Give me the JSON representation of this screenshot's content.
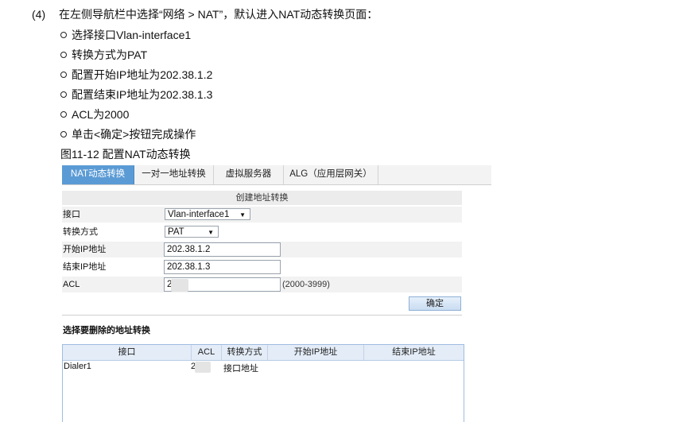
{
  "instructions": {
    "step_number": "(4)",
    "step_text": "在左侧导航栏中选择“网络 > NAT”，默认进入NAT动态转换页面：",
    "bullets": [
      "选择接口Vlan-interface1",
      "转换方式为PAT",
      "配置开始IP地址为202.38.1.2",
      "配置结束IP地址为202.38.1.3",
      "ACL为2000",
      "单击<确定>按钮完成操作"
    ],
    "figure_caption": "图11-12 配置NAT动态转换"
  },
  "tabs": [
    "NAT动态转换",
    "一对一地址转换",
    "虚拟服务器",
    "ALG（应用层网关）"
  ],
  "form": {
    "title": "创建地址转换",
    "interface_label": "接口",
    "interface_value": "Vlan-interface1",
    "mode_label": "转换方式",
    "mode_value": "PAT",
    "start_ip_label": "开始IP地址",
    "start_ip_value": "202.38.1.2",
    "end_ip_label": "结束IP地址",
    "end_ip_value": "202.38.1.3",
    "acl_label": "ACL",
    "acl_value": "2",
    "acl_hint": "(2000-3999)",
    "ok_label": "确定"
  },
  "list": {
    "title": "选择要删除的地址转换",
    "columns": [
      "接口",
      "ACL",
      "转换方式",
      "开始IP地址",
      "结束IP地址"
    ],
    "rows": [
      {
        "interface": "Dialer1",
        "acl": "2",
        "mode": "接口地址",
        "start_ip": "",
        "end_ip": ""
      }
    ]
  },
  "colors": {
    "active_tab": "#5b9bd5",
    "table_header": "#e3ecf7",
    "button": "#c9dcf1"
  }
}
